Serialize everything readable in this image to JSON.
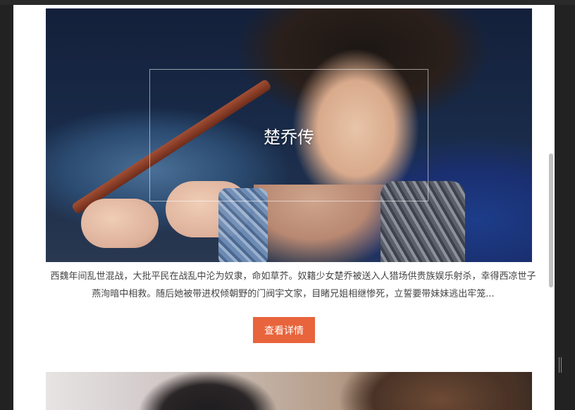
{
  "card": {
    "title": "楚乔传",
    "description_line1": "西魏年间乱世混战，大批平民在战乱中沦为奴隶，命如草芥。奴籍少女楚乔被送入人猎场供贵族娱乐射杀，幸得西凉世子",
    "description_line2": "燕洵暗中相救。随后她被带进权倾朝野的门阀宇文家，目睹兄姐相继惨死，立誓要带妹妹逃出牢笼...",
    "button_label": "查看详情"
  },
  "colors": {
    "button_bg": "#e8643c",
    "page_bg": "#ffffff",
    "outer_bg": "#222222"
  }
}
